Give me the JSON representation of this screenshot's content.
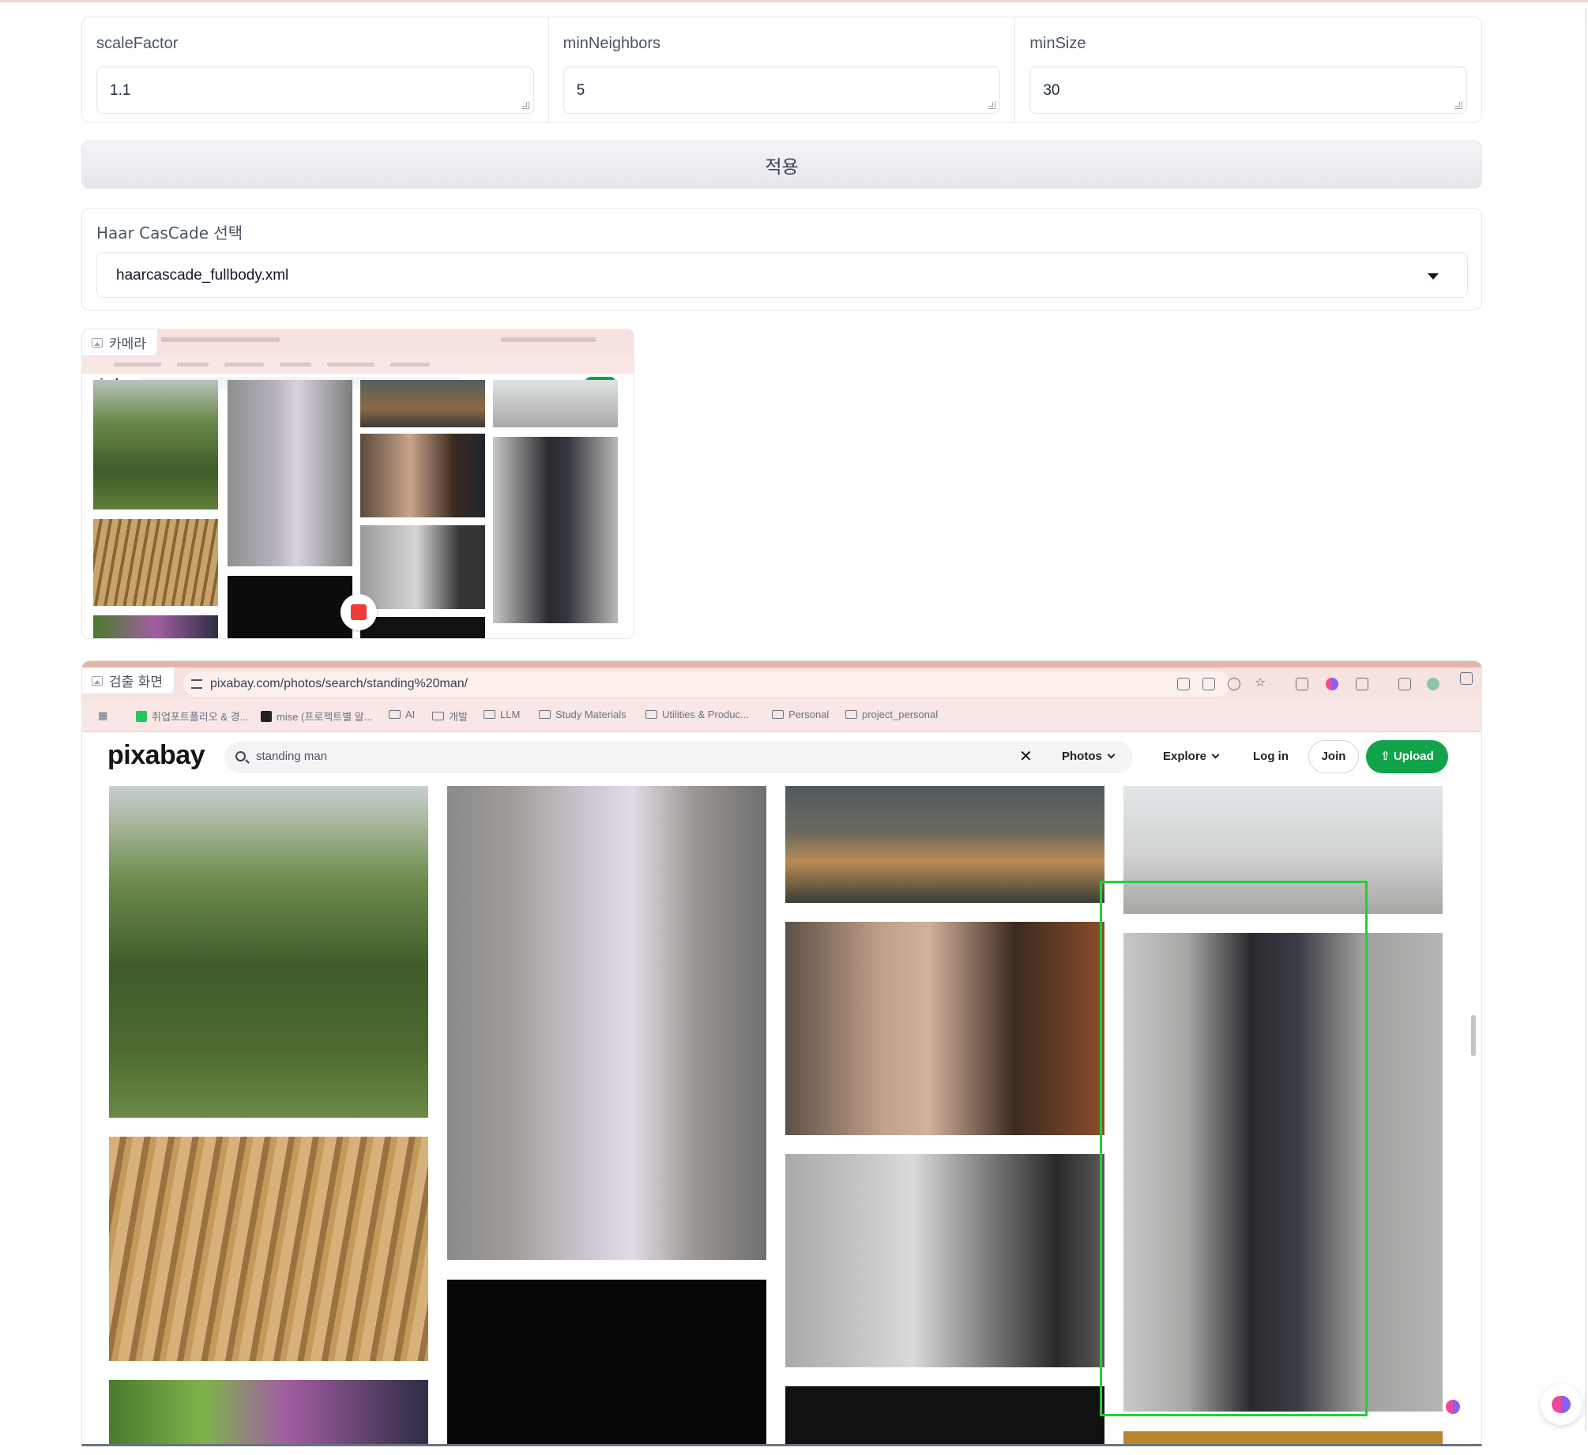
{
  "params": [
    {
      "label": "scaleFactor",
      "value": "1.1"
    },
    {
      "label": "minNeighbors",
      "value": "5"
    },
    {
      "label": "minSize",
      "value": "30"
    }
  ],
  "apply_label": "적용",
  "cascade": {
    "label": "Haar CasCade 선택",
    "selected": "haarcascade_fullbody.xml"
  },
  "camera": {
    "label": "카메라",
    "logo": "pixabay"
  },
  "detection": {
    "label": "검출 화면",
    "url": "pixabay.com/photos/search/standing%20man/",
    "bookmarks": [
      "취업포트폴리오 & 경...",
      "mise (프로젝트별 알...",
      "AI",
      "개발",
      "LLM",
      "Study Materials",
      "Utilities & Produc...",
      "Personal",
      "project_personal"
    ],
    "logo": "pixabay",
    "search_value": "standing man",
    "clear": "✕",
    "photos": "Photos",
    "explore": "Explore",
    "login": "Log in",
    "join": "Join",
    "upload": "Upload"
  },
  "colors": {
    "accent": "#10a34a",
    "detection_box": "#22d03a",
    "record": "#ef3b36",
    "chrome": "#f6e2de"
  }
}
